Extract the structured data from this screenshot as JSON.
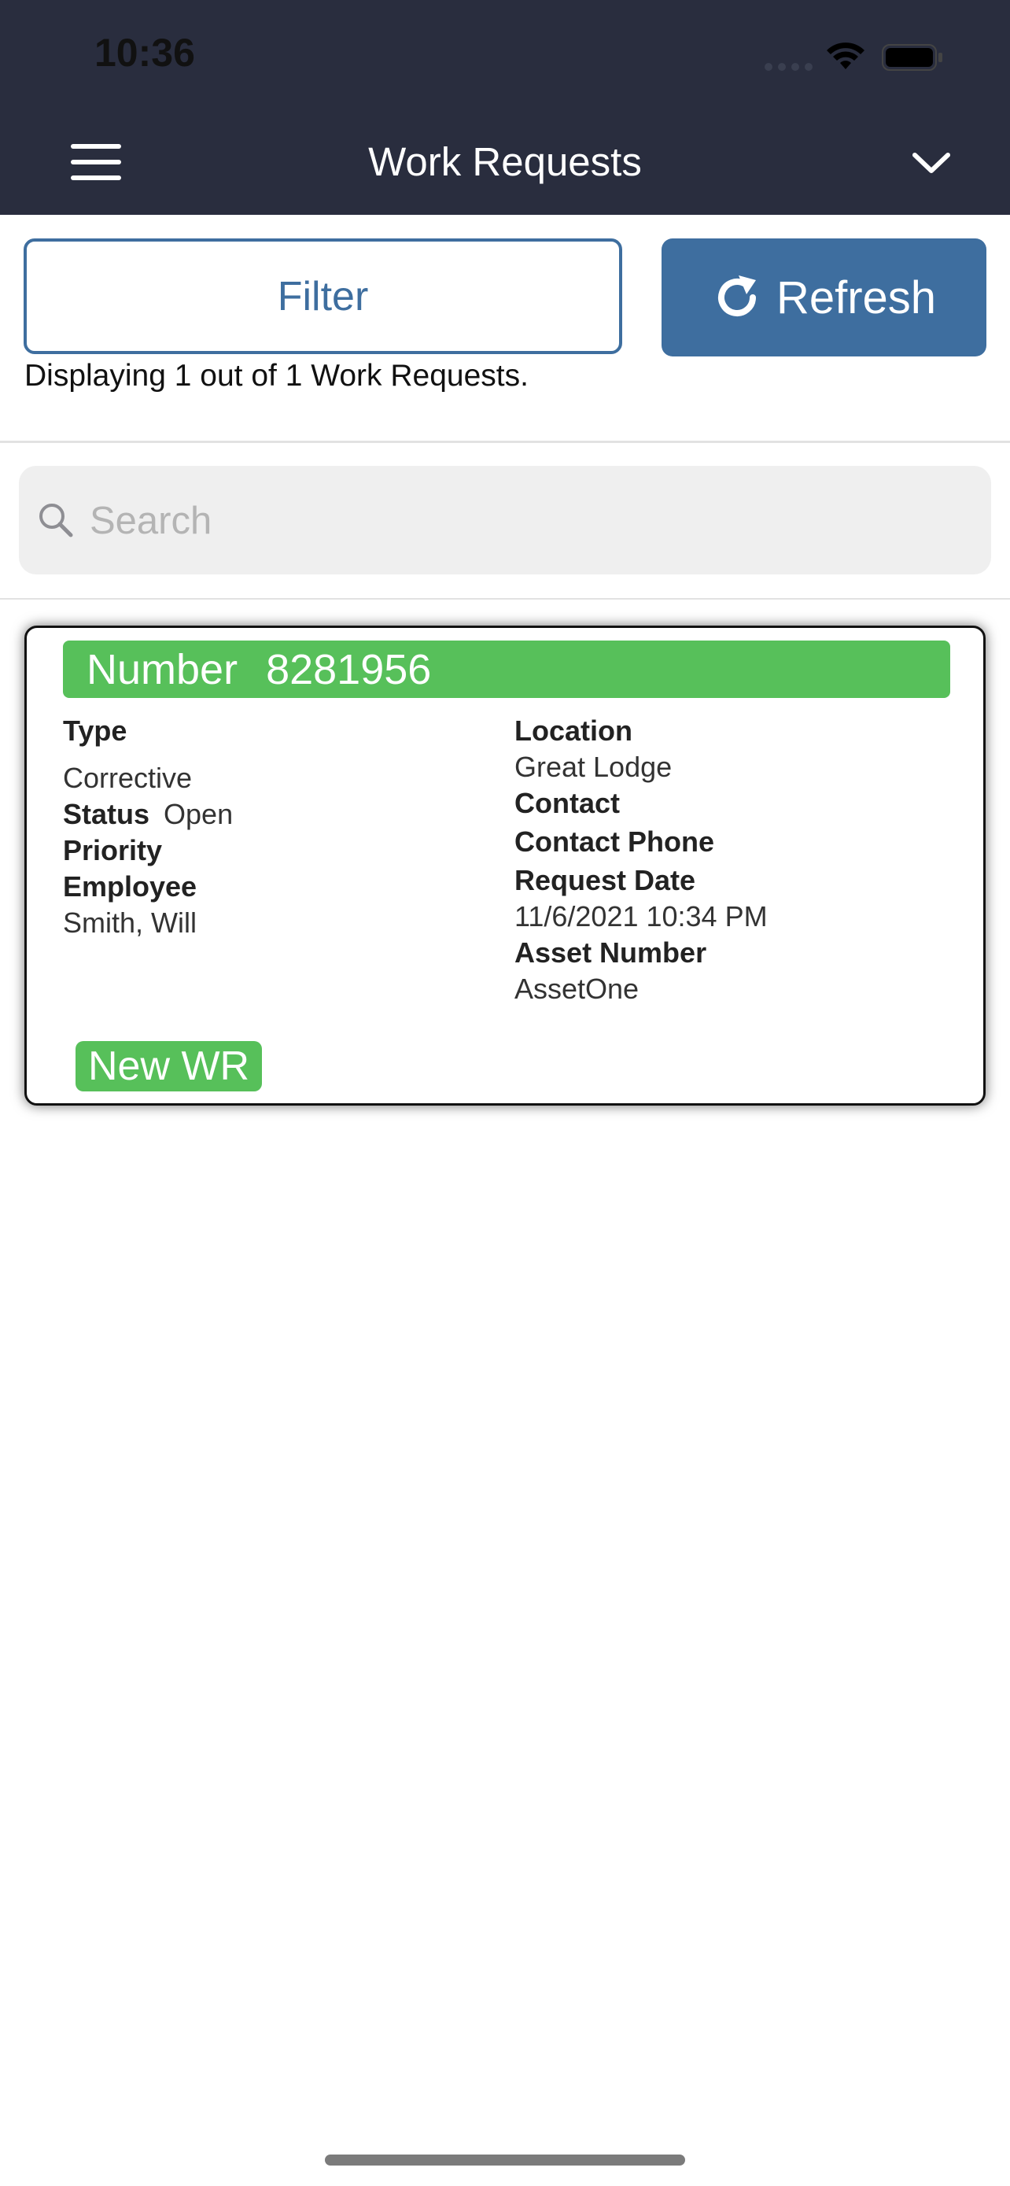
{
  "status_bar": {
    "time": "10:36"
  },
  "header": {
    "title": "Work Requests"
  },
  "toolbar": {
    "filter_label": "Filter",
    "refresh_label": "Refresh"
  },
  "summary": {
    "display_text": "Displaying 1 out of  1 Work Requests."
  },
  "search": {
    "placeholder": "Search",
    "value": ""
  },
  "work_request": {
    "number_label": "Number",
    "number": "8281956",
    "type_label": "Type",
    "type": "Corrective",
    "status_label": "Status",
    "status": "Open",
    "priority_label": "Priority",
    "priority": "",
    "employee_label": "Employee",
    "employee": "Smith, Will",
    "location_label": "Location",
    "location": "Great Lodge",
    "contact_label": "Contact",
    "contact": "",
    "contact_phone_label": "Contact Phone",
    "contact_phone": "",
    "request_date_label": "Request Date",
    "request_date": "11/6/2021 10:34 PM",
    "asset_number_label": "Asset Number",
    "asset_number": "AssetOne",
    "badge": "New WR"
  },
  "colors": {
    "header_bg": "#292d3e",
    "accent_blue": "#3e6e9f",
    "badge_green": "#57c05a"
  },
  "icons": [
    "menu-icon",
    "chevron-down-icon",
    "refresh-icon",
    "search-icon",
    "wifi-icon",
    "battery-icon"
  ]
}
